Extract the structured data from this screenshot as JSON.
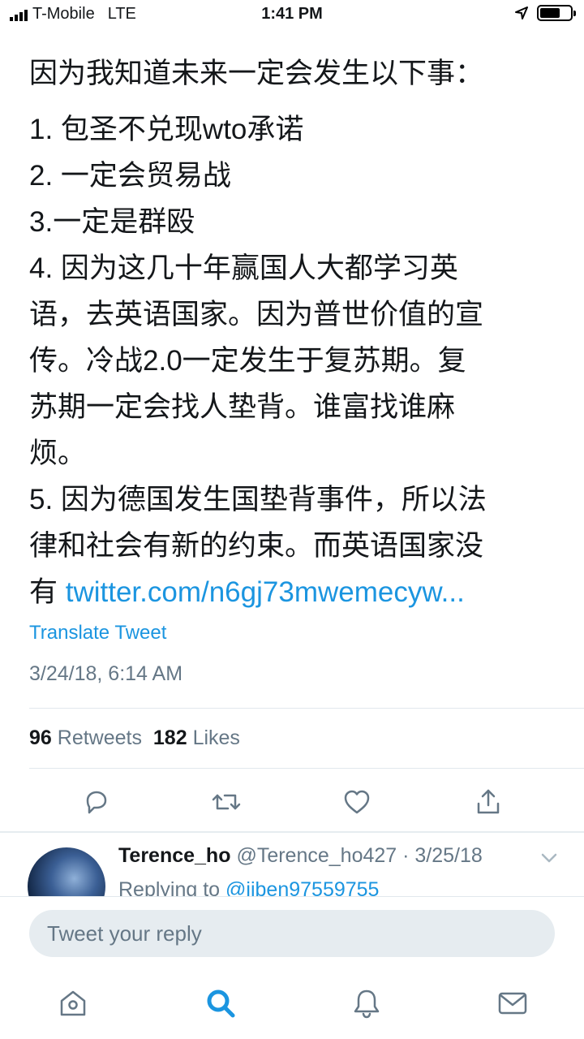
{
  "status_bar": {
    "carrier": "T-Mobile",
    "network": "LTE",
    "time": "1:41 PM"
  },
  "tweet": {
    "lines": [
      "因为我知道未来一定会发生以下事：",
      "1. 包圣不兑现wto承诺",
      "2. 一定会贸易战",
      "3.一定是群殴",
      "4. 因为这几十年赢国人大都学习英",
      "语，去英语国家。因为普世价值的宣",
      "传。冷战2.0一定发生于复苏期。复",
      "苏期一定会找人垫背。谁富找谁麻",
      "烦。",
      "5. 因为德国发生国垫背事件，所以法",
      "律和社会有新的约束。而英语国家没"
    ],
    "last_line_prefix": "有 ",
    "link_text": "twitter.com/n6gj73mwemecyw...",
    "translate_label": "Translate Tweet",
    "timestamp": "3/24/18, 6:14 AM",
    "retweets_count": "96",
    "retweets_label": "Retweets",
    "likes_count": "182",
    "likes_label": "Likes"
  },
  "reply_preview": {
    "name": "Terence_ho",
    "meta": "@Terence_ho427 · 3/25/18",
    "replying_prefix": "Replying to ",
    "replying_handle": "@jiben97559755"
  },
  "composer": {
    "placeholder": "Tweet your reply"
  },
  "icons": {
    "reply": "reply-icon",
    "retweet": "retweet-icon",
    "like": "heart-icon",
    "share": "share-icon",
    "home": "home-icon",
    "search": "search-icon",
    "notifications": "bell-icon",
    "messages": "mail-icon",
    "location": "location-arrow-icon",
    "battery": "battery-icon"
  },
  "colors": {
    "accent": "#1b95e0",
    "text": "#14171a",
    "secondary": "#657786",
    "input_bg": "#e6ecf0"
  }
}
